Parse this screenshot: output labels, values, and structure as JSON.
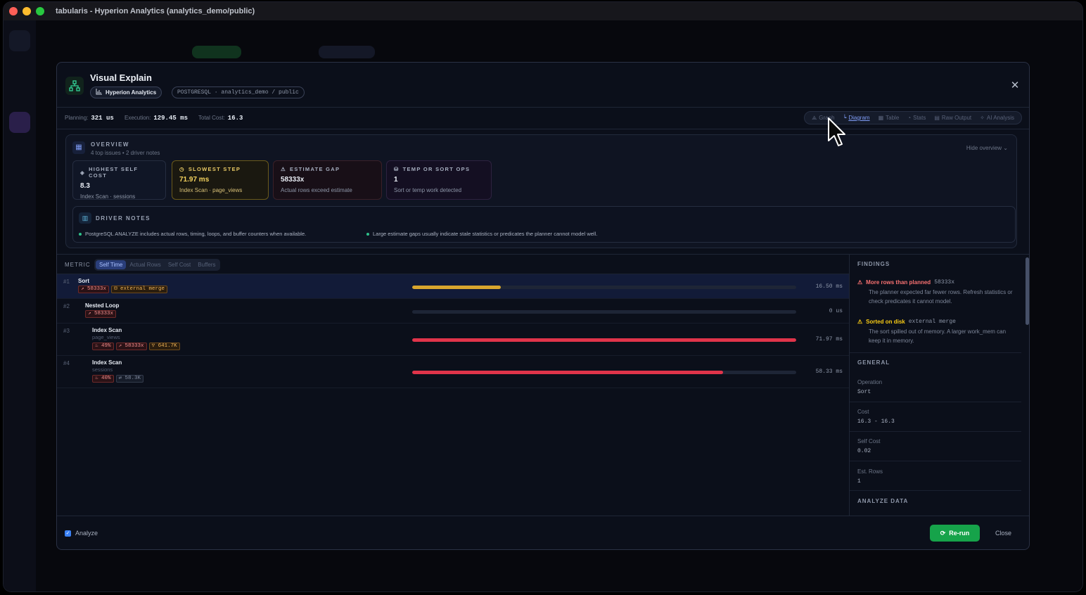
{
  "window": {
    "title": "tabularis - Hyperion Analytics (analytics_demo/public)"
  },
  "modal": {
    "title": "Visual Explain",
    "connection_chip": "Hyperion Analytics",
    "db_chip": "POSTGRESQL · analytics_demo / public",
    "close_icon": "close-icon"
  },
  "stats": {
    "planning_label": "Planning:",
    "planning_value": "321 us",
    "execution_label": "Execution:",
    "execution_value": "129.45 ms",
    "cost_label": "Total Cost:",
    "cost_value": "16.3"
  },
  "view_tabs": [
    {
      "label": "Graph",
      "icon": "graph-icon"
    },
    {
      "label": "Diagram",
      "icon": "bar-chart-icon",
      "active": true
    },
    {
      "label": "Table",
      "icon": "table-icon"
    },
    {
      "label": "Stats",
      "icon": "stats-icon"
    },
    {
      "label": "Raw Output",
      "icon": "file-icon"
    },
    {
      "label": "AI Analysis",
      "icon": "sparkle-icon"
    }
  ],
  "overview": {
    "title": "OVERVIEW",
    "subtitle": "4 top issues • 2 driver notes",
    "hide_label": "Hide overview",
    "cards": [
      {
        "key": "HIGHEST SELF COST",
        "value": "8.3",
        "desc": "Index Scan · sessions",
        "color": "#e9edf5"
      },
      {
        "key": "SLOWEST STEP",
        "value": "71.97 ms",
        "desc": "Index Scan · page_views",
        "color": "#f5d35e"
      },
      {
        "key": "ESTIMATE GAP",
        "value": "58333x",
        "desc": "Actual rows exceed estimate",
        "color": "#e9edf5"
      },
      {
        "key": "TEMP OR SORT OPS",
        "value": "1",
        "desc": "Sort or temp work detected",
        "color": "#e9edf5"
      }
    ],
    "notes_title": "DRIVER NOTES",
    "notes": [
      "PostgreSQL ANALYZE includes actual rows, timing, loops, and buffer counters when available.",
      "Large estimate gaps usually indicate stale statistics or predicates the planner cannot model well."
    ]
  },
  "metric": {
    "label": "METRIC",
    "tabs": [
      "Self Time",
      "Actual Rows",
      "Self Cost",
      "Buffers"
    ],
    "active": "Self Time"
  },
  "rows": [
    {
      "num": "#1",
      "name": "Sort",
      "sub": "",
      "value": "16.50 ms",
      "fraction": 0.23,
      "color": "#d9a62e",
      "badges": [
        {
          "t": "↗ 58333x",
          "k": "r"
        },
        {
          "t": "⊟ external merge",
          "k": "o"
        }
      ]
    },
    {
      "num": "#2",
      "name": "Nested Loop",
      "sub": "",
      "value": "0 us",
      "fraction": 0,
      "color": "#e0344a",
      "badges": [
        {
          "t": "↗ 58333x",
          "k": "r"
        }
      ]
    },
    {
      "num": "#3",
      "name": "Index Scan",
      "sub": "page_views",
      "value": "71.97 ms",
      "fraction": 1.0,
      "color": "#e0344a",
      "badges": [
        {
          "t": "♨ 49%",
          "k": "r"
        },
        {
          "t": "↗ 58333x",
          "k": "r"
        },
        {
          "t": "▽ 641.7K",
          "k": "o"
        }
      ]
    },
    {
      "num": "#4",
      "name": "Index Scan",
      "sub": "sessions",
      "value": "58.33 ms",
      "fraction": 0.81,
      "color": "#e0344a",
      "badges": [
        {
          "t": "♨ 40%",
          "k": "r"
        },
        {
          "t": "⇄ 58.3K",
          "k": "g"
        }
      ]
    }
  ],
  "findings": {
    "title": "FINDINGS",
    "items": [
      {
        "title": "More rows than planned",
        "tag": "58333x",
        "text": "The planner expected far fewer rows. Refresh statistics or check predicates it cannot model.",
        "color": "#f87171"
      },
      {
        "title": "Sorted on disk",
        "tag": "external merge",
        "text": "The sort spilled out of memory. A larger work_mem can keep it in memory.",
        "color": "#facc15"
      }
    ]
  },
  "general": {
    "title": "GENERAL",
    "fields": [
      {
        "k": "Operation",
        "v": "Sort"
      },
      {
        "k": "Cost",
        "v": "16.3 - 16.3"
      },
      {
        "k": "Self Cost",
        "v": "0.02"
      },
      {
        "k": "Est. Rows",
        "v": "1"
      }
    ],
    "analyze_title": "ANALYZE DATA"
  },
  "footer": {
    "analyze_label": "Analyze",
    "rerun_label": "Re-run",
    "close_label": "Close"
  }
}
